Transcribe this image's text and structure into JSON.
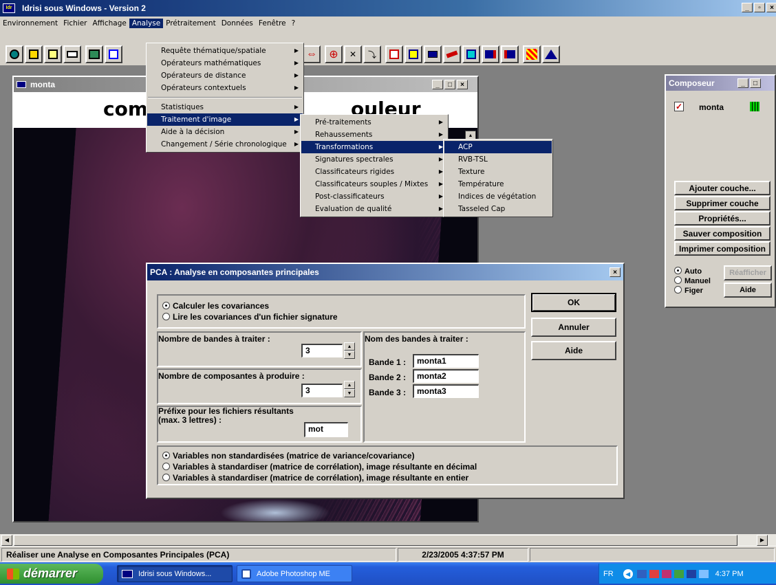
{
  "app": {
    "title": "Idrisi sous Windows  -  Version 2",
    "menubar": [
      "Environnement",
      "Fichier",
      "Affichage",
      "Analyse",
      "Prétraitement",
      "Données",
      "Fenêtre",
      "?"
    ]
  },
  "analyse_menu": [
    "Requête thématique/spatiale",
    "Opérateurs mathématiques",
    "Opérateurs de distance",
    "Opérateurs contextuels",
    "Statistiques",
    "Traitement d'image",
    "Aide à la décision",
    "Changement / Série chronologique"
  ],
  "image_menu": [
    "Pré-traitements",
    "Rehaussements",
    "Transformations",
    "Signatures spectrales",
    "Classificateurs rigides",
    "Classificateurs souples / Mixtes",
    "Post-classificateurs",
    "Evaluation de qualité"
  ],
  "transform_menu": [
    "ACP",
    "RVB-TSL",
    "Texture",
    "Température",
    "Indices de végétation",
    "Tasseled Cap"
  ],
  "map_window": {
    "title": "monta",
    "heading_left": "com",
    "heading_right": "ouleur"
  },
  "composer": {
    "title": "Composeur",
    "layer": "monta",
    "buttons": [
      "Ajouter couche...",
      "Supprimer couche",
      "Propriétés...",
      "Sauver composition",
      "Imprimer composition"
    ],
    "modes": [
      "Auto",
      "Manuel",
      "Figer"
    ],
    "refresh": "Réafficher",
    "help": "Aide"
  },
  "dialog": {
    "title": "PCA : Analyse en composantes principales",
    "cov_options": [
      "Calculer les covariances",
      "Lire les covariances d'un fichier signature"
    ],
    "nbands_label": "Nombre de bandes à traiter :",
    "nbands_value": "3",
    "ncomp_label": "Nombre de composantes à produire :",
    "ncomp_value": "3",
    "prefix_label": "Préfixe pour les fichiers résultants (max. 3 lettres) :",
    "prefix_value": "mot",
    "bands_title": "Nom des bandes à traiter :",
    "bands": [
      {
        "label": "Bande 1 :",
        "value": "monta1"
      },
      {
        "label": "Bande 2 :",
        "value": "monta2"
      },
      {
        "label": "Bande 3 :",
        "value": "monta3"
      }
    ],
    "std_options": [
      "Variables non standardisées (matrice de variance/covariance)",
      "Variables à standardiser (matrice de corrélation), image résultante en décimal",
      "Variables à standardiser (matrice de corrélation), image résultante en entier"
    ],
    "ok": "OK",
    "cancel": "Annuler",
    "help": "Aide"
  },
  "status": {
    "message": "Réaliser une Analyse en Composantes Principales (PCA)",
    "datetime": "2/23/2005 4:37:57 PM"
  },
  "taskbar": {
    "start": "démarrer",
    "tasks": [
      "Idrisi sous Windows...",
      "Adobe Photoshop ME"
    ],
    "lang": "FR",
    "clock": "4:37 PM"
  },
  "colors": {
    "title_dark": "#0a246a",
    "title_light": "#a6caf0",
    "taskbar": "#245edb",
    "start": "#3c9a3c"
  }
}
